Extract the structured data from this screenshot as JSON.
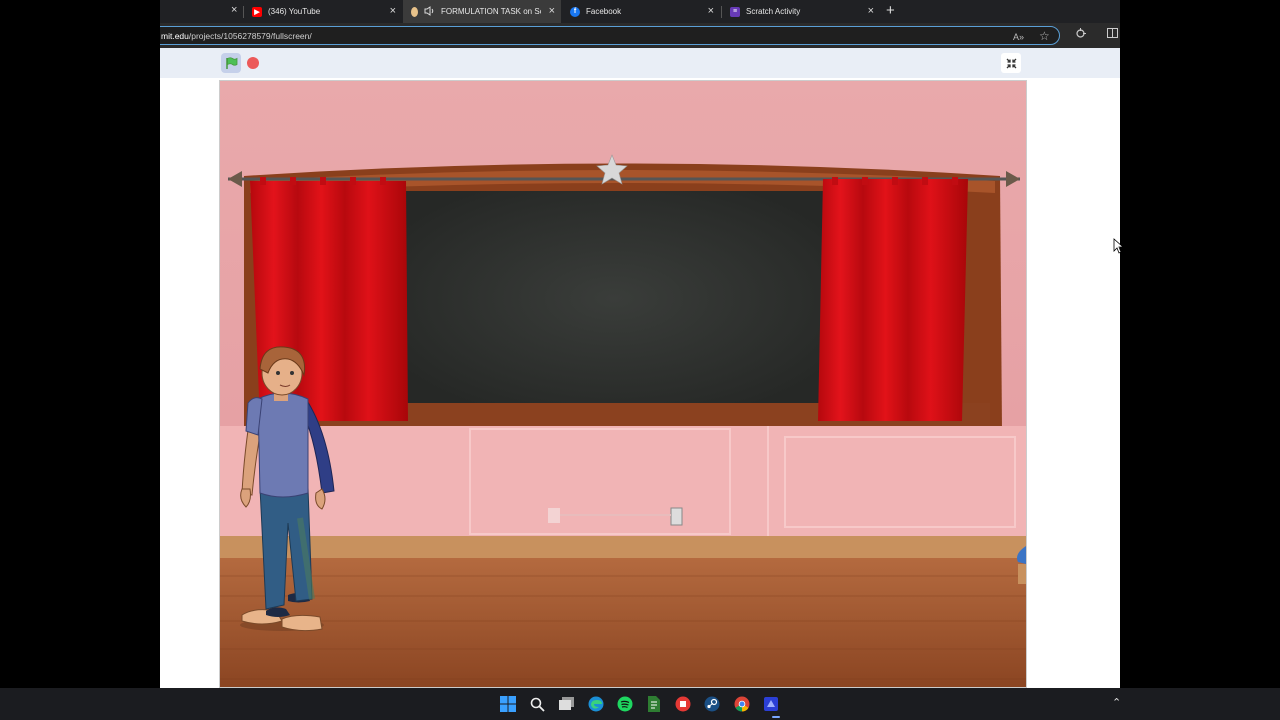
{
  "browser": {
    "tabs": [
      {
        "title": "(346) YouTube",
        "icon": "youtube-icon",
        "color": "#ff0000"
      },
      {
        "title": "FORMULATION TASK on Scr",
        "icon": "tab-favicon-icon",
        "color": "#e8c28a",
        "active": true
      },
      {
        "title": "Facebook",
        "icon": "facebook-icon",
        "color": "#1877f2"
      },
      {
        "title": "Scratch Activity",
        "icon": "form-icon",
        "color": "#673ab7"
      }
    ],
    "url_host": "mit.edu",
    "url_path": "/projects/1056278579/fullscreen/"
  },
  "scratch": {
    "colors": {
      "flag": "#4cbf56",
      "stop": "#ec5959",
      "toolbar": "#e9eef6"
    }
  },
  "taskbar": {
    "icons": [
      "windows-start-icon",
      "search-icon",
      "task-view-icon",
      "edge-icon",
      "spotify-icon",
      "file-app-icon",
      "red-app-icon",
      "steam-icon",
      "chrome-icon",
      "blue-app-icon"
    ]
  }
}
